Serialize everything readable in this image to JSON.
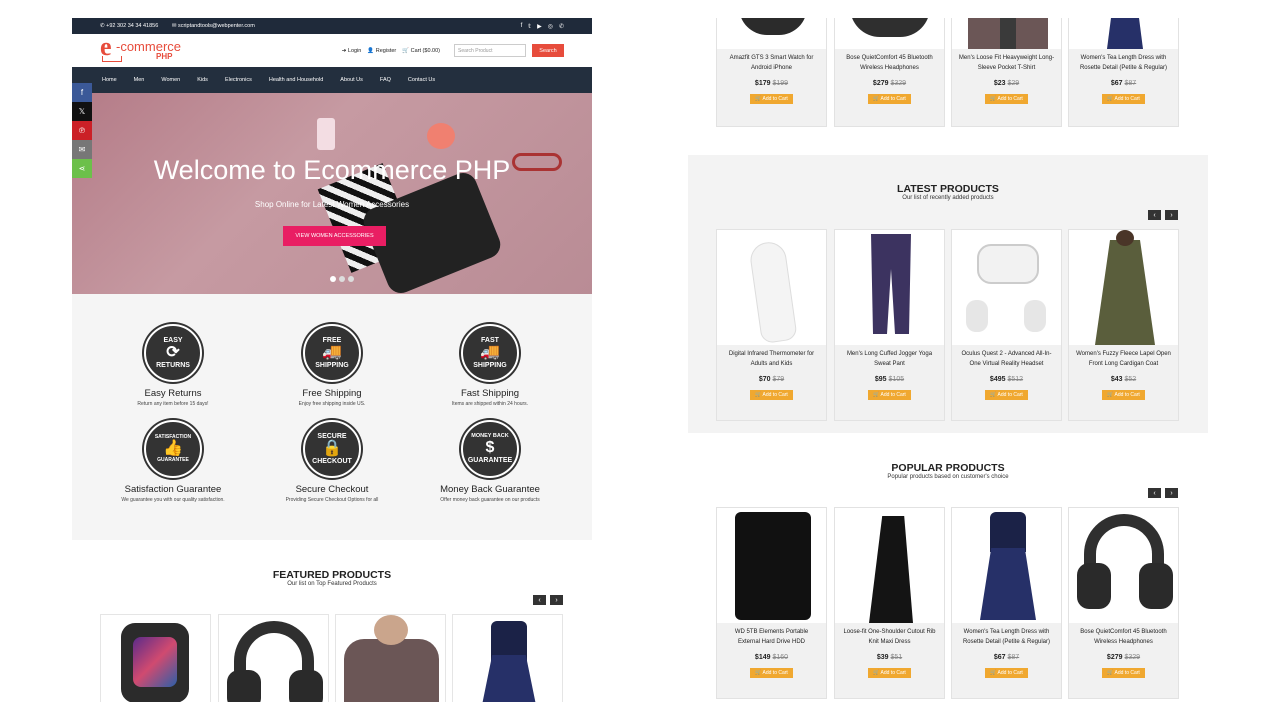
{
  "left": {
    "topbar": {
      "phone": "+92 302 34 34 41856",
      "email": "scriptandtools@webpenter.com"
    },
    "logo": {
      "e": "e",
      "commerce": "-commerce",
      "php": "PHP"
    },
    "header": {
      "login": "Login",
      "register": "Register",
      "cart": "Cart ($0.00)",
      "search_placeholder": "Search Product",
      "search_button": "Search"
    },
    "nav": [
      "Home",
      "Men",
      "Women",
      "Kids",
      "Electronics",
      "Health and Household",
      "About Us",
      "FAQ",
      "Contact Us"
    ],
    "hero": {
      "title": "Welcome to Ecommerce PHP",
      "subtitle": "Shop Online for Latest Women Accessories",
      "button": "VIEW WOMEN ACCESSORIES",
      "slides": 3,
      "active_slide": 1
    },
    "services": [
      {
        "badge_top": "EASY",
        "badge_bottom": "RETURNS",
        "title": "Easy Returns",
        "desc": "Return any item before 15 days!"
      },
      {
        "badge_top": "FREE",
        "badge_bottom": "SHIPPING",
        "title": "Free Shipping",
        "desc": "Enjoy free shipping inside US."
      },
      {
        "badge_top": "FAST",
        "badge_bottom": "SHIPPING",
        "title": "Fast Shipping",
        "desc": "Items are shipped within 24 hours."
      },
      {
        "badge_top": "SATISFACTION",
        "badge_bottom": "GUARANTEE",
        "title": "Satisfaction Guarantee",
        "desc": "We guarantee you with our quality satisfaction."
      },
      {
        "badge_top": "SECURE",
        "badge_bottom": "CHECKOUT",
        "title": "Secure Checkout",
        "desc": "Providing Secure Checkout Options for all"
      },
      {
        "badge_top": "MONEY BACK",
        "badge_bottom": "GUARANTEE",
        "title": "Money Back Guarantee",
        "desc": "Offer money back guarantee on our products"
      }
    ],
    "featured": {
      "title": "FEATURED PRODUCTS",
      "subtitle": "Our list on Top Featured Products"
    }
  },
  "right": {
    "top_products": [
      {
        "name": "Amazfit GTS 3 Smart Watch for Android iPhone",
        "price": "$179",
        "old_price": "$199"
      },
      {
        "name": "Bose QuietComfort 45 Bluetooth Wireless Headphones",
        "price": "$279",
        "old_price": "$329"
      },
      {
        "name": "Men's Loose Fit Heavyweight Long-Sleeve Pocket T-Shirt",
        "price": "$23",
        "old_price": "$29"
      },
      {
        "name": "Women's Tea Length Dress with Rosette Detail (Petite & Regular)",
        "price": "$67",
        "old_price": "$87"
      }
    ],
    "latest": {
      "title": "LATEST PRODUCTS",
      "subtitle": "Our list of recently added products",
      "products": [
        {
          "name": "Digital Infrared Thermometer for Adults and Kids",
          "price": "$70",
          "old_price": "$79"
        },
        {
          "name": "Men's Long Cuffed Jogger Yoga Sweat Pant",
          "price": "$95",
          "old_price": "$105"
        },
        {
          "name": "Oculus Quest 2 - Advanced All-In-One Virtual Reality Headset",
          "price": "$495",
          "old_price": "$512"
        },
        {
          "name": "Women's Fuzzy Fleece Lapel Open Front Long Cardigan Coat",
          "price": "$43",
          "old_price": "$52"
        }
      ]
    },
    "popular": {
      "title": "POPULAR PRODUCTS",
      "subtitle": "Popular products based on customer's choice",
      "products": [
        {
          "name": "WD 5TB Elements Portable External Hard Drive HDD",
          "price": "$149",
          "old_price": "$160"
        },
        {
          "name": "Loose-fit One-Shoulder Cutout Rib Knit Maxi Dress",
          "price": "$39",
          "old_price": "$51"
        },
        {
          "name": "Women's Tea Length Dress with Rosette Detail (Petite & Regular)",
          "price": "$67",
          "old_price": "$87"
        },
        {
          "name": "Bose QuietComfort 45 Bluetooth Wireless Headphones",
          "price": "$279",
          "old_price": "$329"
        }
      ]
    },
    "add_to_cart": "Add to Cart"
  },
  "colors": {
    "accent_red": "#e74c3c",
    "nav_dark": "#232f3e",
    "hero_button": "#e91e63",
    "cart_button": "#f0a830"
  }
}
